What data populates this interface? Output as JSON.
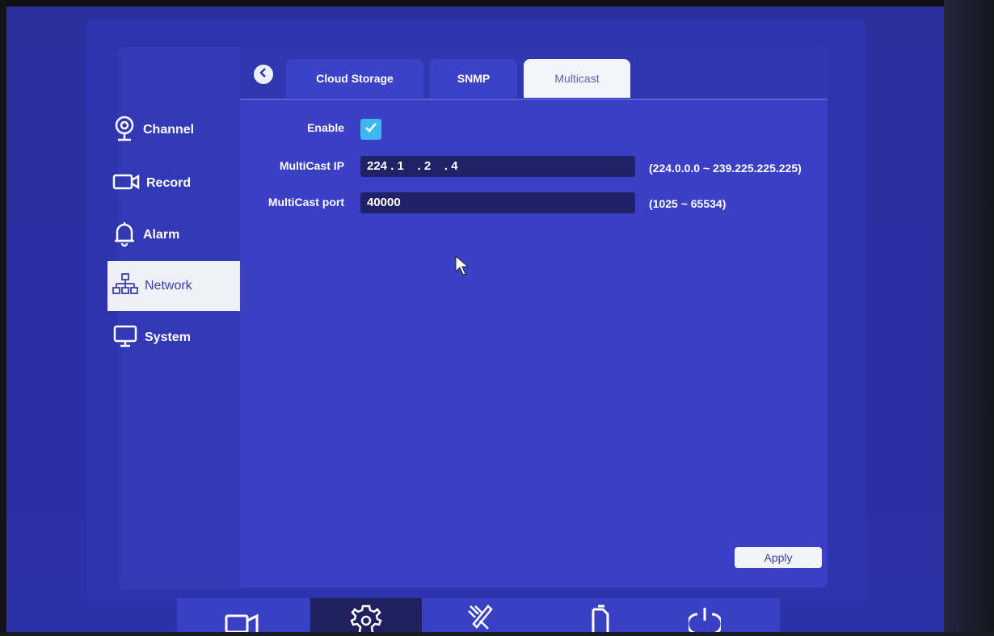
{
  "sidebar": {
    "items": [
      {
        "label": "Channel",
        "icon": "webcam-icon"
      },
      {
        "label": "Record",
        "icon": "video-camera-icon"
      },
      {
        "label": "Alarm",
        "icon": "bell-icon"
      },
      {
        "label": "Network",
        "icon": "network-icon",
        "active": true
      },
      {
        "label": "System",
        "icon": "monitor-icon"
      }
    ]
  },
  "tabs": [
    {
      "label": "Cloud Storage"
    },
    {
      "label": "SNMP"
    },
    {
      "label": "Multicast",
      "active": true
    }
  ],
  "form": {
    "enable_label": "Enable",
    "enable_checked": true,
    "ip_label": "MultiCast IP",
    "ip_value": "224 . 1    . 2    . 4",
    "ip_hint": "(224.0.0.0 ~ 239.225.225.225)",
    "port_label": "MultiCast port",
    "port_value": "40000",
    "port_hint": "(1025 ~ 65534)"
  },
  "apply_label": "Apply",
  "bottom_toolbar": [
    "video-camera-icon",
    "gear-icon",
    "tools-icon",
    "files-icon",
    "power-icon"
  ],
  "colors": {
    "accent": "#2d33ac",
    "checkbox": "#41b7f0"
  }
}
